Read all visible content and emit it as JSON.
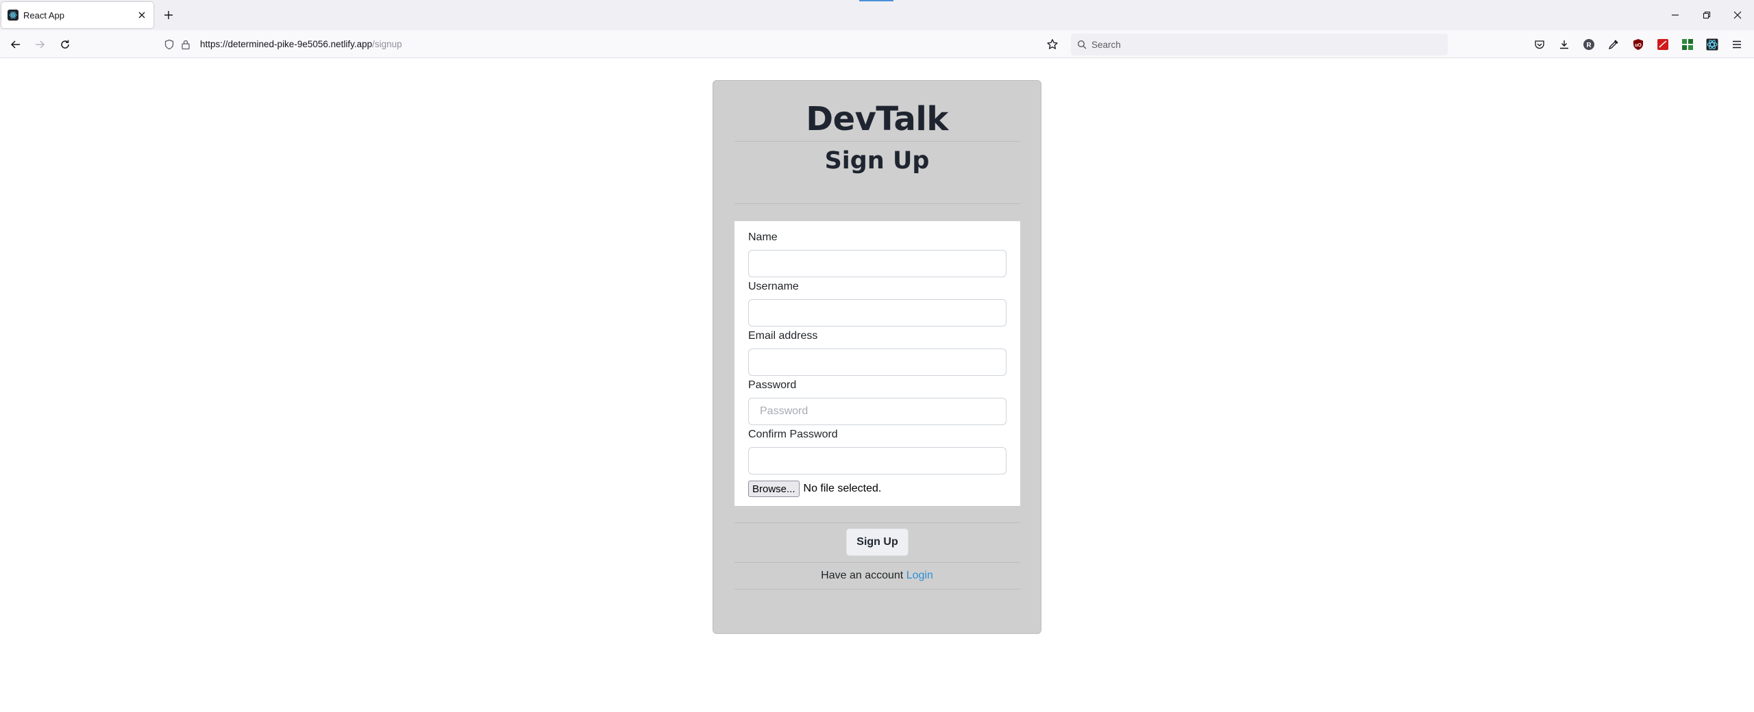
{
  "browser": {
    "tab_title": "React App",
    "url_host": "https://determined-pike-9e5056.netlify.app",
    "url_path": "/signup",
    "search_placeholder": "Search"
  },
  "page": {
    "brand": "DevTalk",
    "heading": "Sign Up",
    "fields": {
      "name_label": "Name",
      "username_label": "Username",
      "email_label": "Email address",
      "password_label": "Password",
      "password_placeholder": "Password",
      "confirm_label": "Confirm Password"
    },
    "file": {
      "button_label": "Browse...",
      "status": "No file selected."
    },
    "submit_label": "Sign Up",
    "account_prompt": "Have an account",
    "login_link": "Login"
  },
  "colors": {
    "card_bg": "#cfcfcf",
    "link": "#2d8fd6",
    "heading": "#1f2530"
  }
}
